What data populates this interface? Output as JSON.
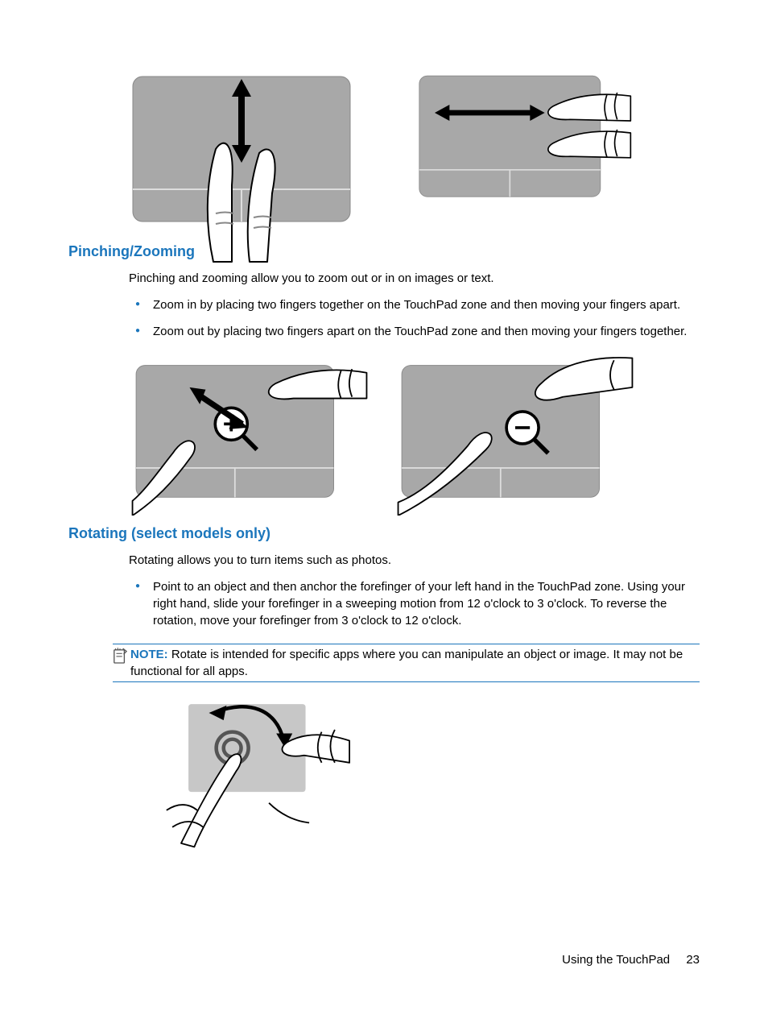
{
  "sections": {
    "pinch": {
      "heading": "Pinching/Zooming",
      "intro": "Pinching and zooming allow you to zoom out or in on images or text.",
      "bullets": [
        "Zoom in by placing two fingers together on the TouchPad zone and then moving your fingers apart.",
        "Zoom out by placing two fingers apart on the TouchPad zone and then moving your fingers together."
      ]
    },
    "rotate": {
      "heading": "Rotating (select models only)",
      "intro": "Rotating allows you to turn items such as photos.",
      "bullets": [
        "Point to an object and then anchor the forefinger of your left hand in the TouchPad zone. Using your right hand, slide your forefinger in a sweeping motion from 12 o'clock to 3 o'clock. To reverse the rotation, move your forefinger from 3 o'clock to 12 o'clock."
      ],
      "note_label": "NOTE:",
      "note_text": "Rotate is intended for specific apps where you can manipulate an object or image. It may not be functional for all apps."
    }
  },
  "footer": {
    "text": "Using the TouchPad",
    "page": "23"
  }
}
